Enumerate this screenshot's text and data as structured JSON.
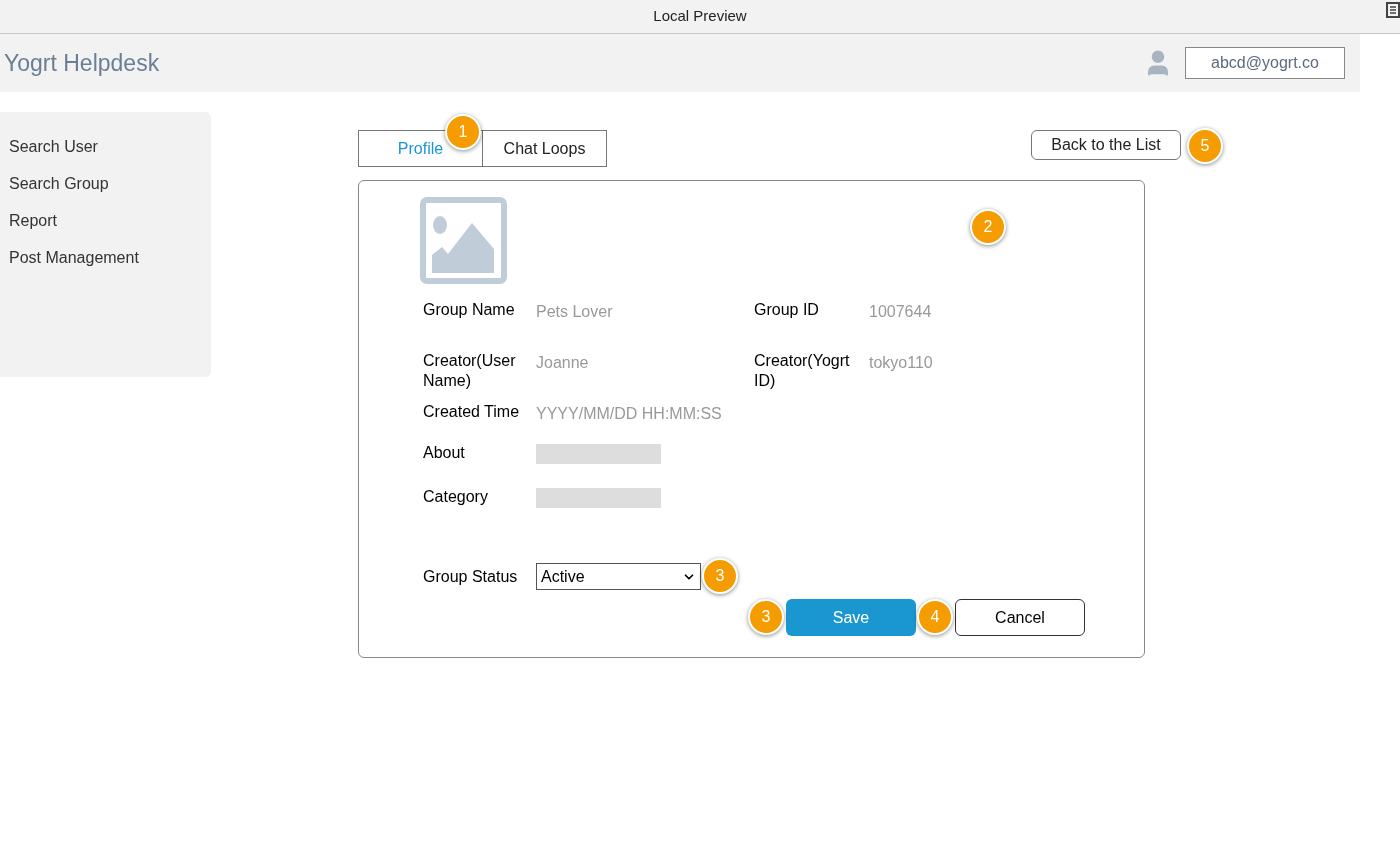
{
  "window": {
    "title": "Local Preview"
  },
  "header": {
    "app_name": "Yogrt Helpdesk",
    "account": "abcd@yogrt.co"
  },
  "sidebar": {
    "items": [
      {
        "label": "Search User"
      },
      {
        "label": "Search Group"
      },
      {
        "label": "Report"
      },
      {
        "label": "Post Management"
      }
    ]
  },
  "tabs": [
    {
      "label": "Profile",
      "selected": true,
      "badge": "1"
    },
    {
      "label": "Chat Loops",
      "selected": false
    }
  ],
  "back_button": {
    "label": "Back to the List",
    "badge": "5"
  },
  "card": {
    "badge": "2",
    "rows": [
      {
        "cells": [
          {
            "label": "Group Name",
            "kind": "text",
            "value": "Pets Lover"
          },
          {
            "label": "Group ID",
            "kind": "text",
            "value": "1007644"
          }
        ]
      },
      {
        "cells": [
          {
            "label": "Creator(User Name)",
            "kind": "text",
            "value": "Joanne"
          },
          {
            "label": "Creator(Yogrt ID)",
            "kind": "text",
            "value": "tokyo110"
          }
        ]
      },
      {
        "cells": [
          {
            "label": "Created Time",
            "kind": "text",
            "value": "YYYY/MM/DD HH:MM:SS"
          }
        ]
      },
      {
        "cells": [
          {
            "label": "About",
            "kind": "blank"
          }
        ]
      },
      {
        "cells": [
          {
            "label": "Category",
            "kind": "blank"
          }
        ]
      }
    ],
    "status": {
      "label": "Group Status",
      "value": "Active",
      "badge": "3"
    },
    "save": {
      "label": "Save",
      "badge": "3"
    },
    "cancel": {
      "label": "Cancel",
      "badge": "4"
    }
  }
}
